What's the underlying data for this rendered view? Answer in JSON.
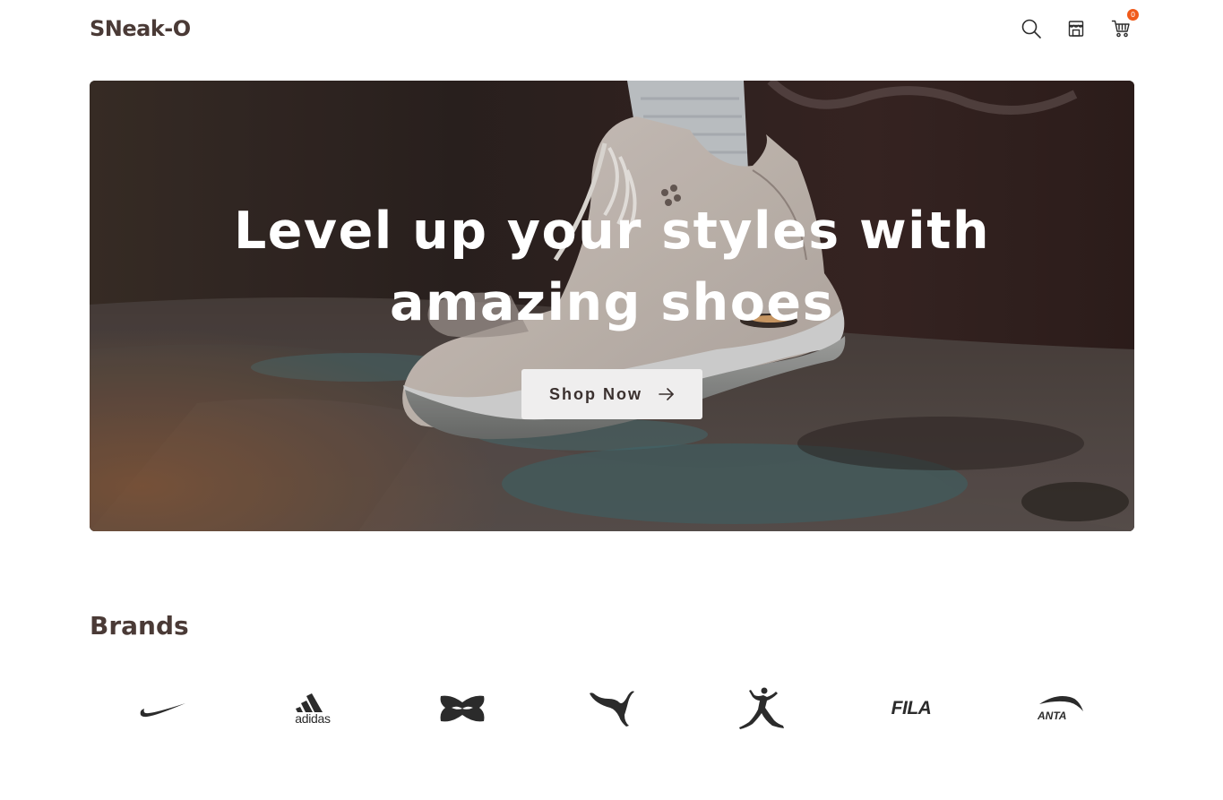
{
  "header": {
    "logo": "SNeak-O",
    "icons": [
      "search-icon",
      "store-icon",
      "cart-icon"
    ],
    "cart_count": "0"
  },
  "hero": {
    "title": "Level up your styles with amazing shoes",
    "button_label": "Shop Now",
    "button_icon": "arrow-right-icon"
  },
  "brands": {
    "title": "Brands",
    "items": [
      {
        "name": "nike",
        "logo_text": ""
      },
      {
        "name": "adidas",
        "logo_text": "adidas"
      },
      {
        "name": "under-armour",
        "logo_text": ""
      },
      {
        "name": "puma",
        "logo_text": ""
      },
      {
        "name": "jordan",
        "logo_text": ""
      },
      {
        "name": "fila",
        "logo_text": "FILA"
      },
      {
        "name": "anta",
        "logo_text": "ANTA"
      }
    ]
  },
  "colors": {
    "brand_text": "#4a3a36",
    "badge": "#f05a1a",
    "button_bg": "#efeeee",
    "hero_dark": "#2a201e"
  }
}
